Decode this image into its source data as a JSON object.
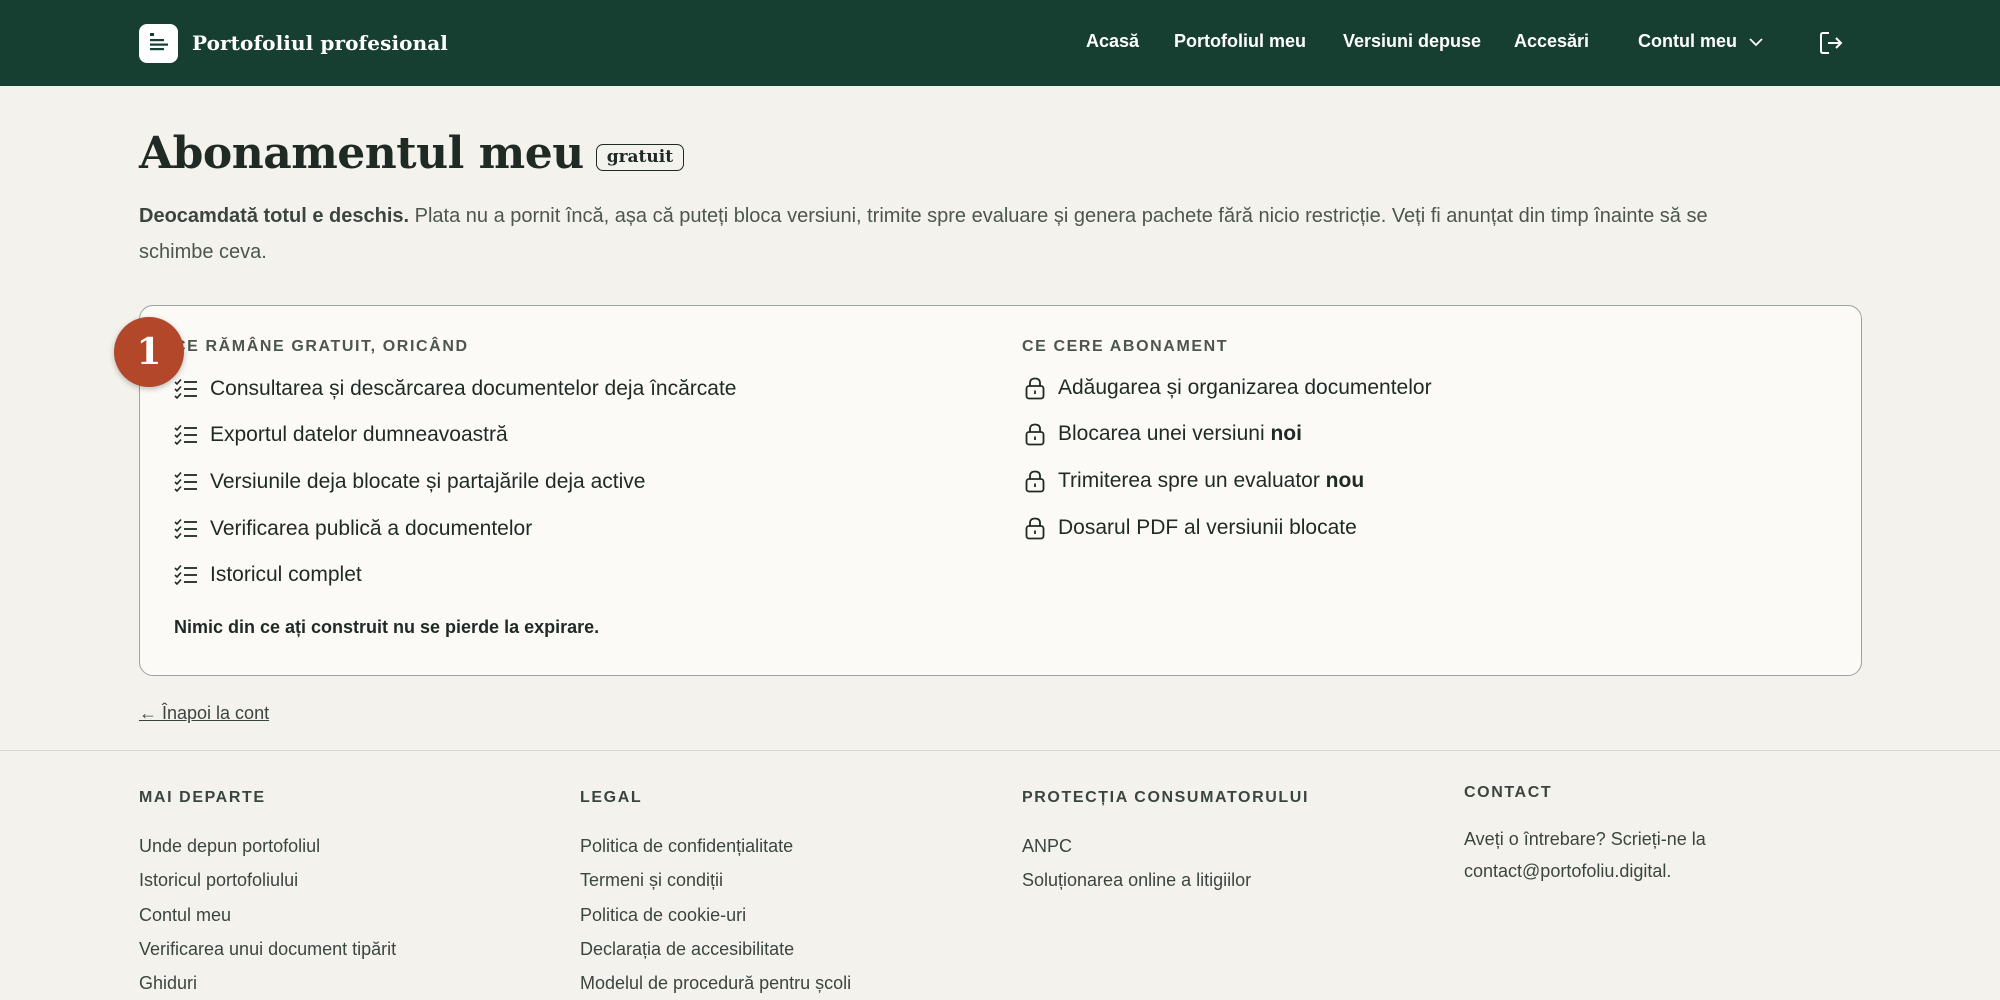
{
  "header": {
    "brand": "Portofoliul profesional",
    "nav": [
      "Acasă",
      "Portofoliul meu",
      "Versiuni depuse",
      "Accesări"
    ],
    "account": "Contul meu"
  },
  "main": {
    "title": "Abonamentul meu",
    "badge": "gratuit",
    "intro_bold": "Deocamdată totul e deschis.",
    "intro_text": " Plata nu a pornit încă, așa că puteți bloca versiuni, trimite spre evaluare și genera pachete fără nicio restricție. Veți fi anunțat din timp înainte să se schimbe ceva.",
    "free_heading": "CE RĂMÂNE GRATUIT, ORICÂND",
    "free_items": [
      "Consultarea și descărcarea documentelor deja încărcate",
      "Exportul datelor dumneavoastră",
      "Versiunile deja blocate și partajările deja active",
      "Verificarea publică a documentelor",
      "Istoricul complet"
    ],
    "paid_heading": "CE CERE ABONAMENT",
    "paid_items": [
      {
        "text": "Adăugarea și organizarea documentelor",
        "bold": ""
      },
      {
        "text": "Blocarea unei versiuni ",
        "bold": "noi"
      },
      {
        "text": "Trimiterea spre un evaluator ",
        "bold": "nou"
      },
      {
        "text": "Dosarul PDF al versiunii blocate",
        "bold": ""
      }
    ],
    "note": "Nimic din ce ați construit nu se pierde la expirare.",
    "step": "1",
    "back": "← Înapoi la cont"
  },
  "footer": {
    "col1": {
      "heading": "MAI DEPARTE",
      "links": [
        "Unde depun portofoliul",
        "Istoricul portofoliului",
        "Contul meu",
        "Verificarea unui document tipărit",
        "Ghiduri"
      ]
    },
    "col2": {
      "heading": "LEGAL",
      "links": [
        "Politica de confidențialitate",
        "Termeni și condiții",
        "Politica de cookie-uri",
        "Declarația de accesibilitate",
        "Modelul de procedură pentru școli"
      ]
    },
    "col3": {
      "heading": "PROTECȚIA CONSUMATORULUI",
      "links": [
        "ANPC",
        "Soluționarea online a litigiilor"
      ]
    },
    "col4": {
      "heading": "CONTACT",
      "text": "Aveți o întrebare? Scrieți-ne la contact@portofoliu.digital."
    }
  },
  "colors": {
    "header_bg": "#173f31",
    "badge_bg": "#b2472a",
    "page_bg": "#f4f2ec"
  },
  "icons": {
    "brand": "document-lines-icon",
    "account": "chevron-down-icon",
    "logout": "logout-icon",
    "free": "checklist-icon",
    "paid": "lock-icon"
  }
}
